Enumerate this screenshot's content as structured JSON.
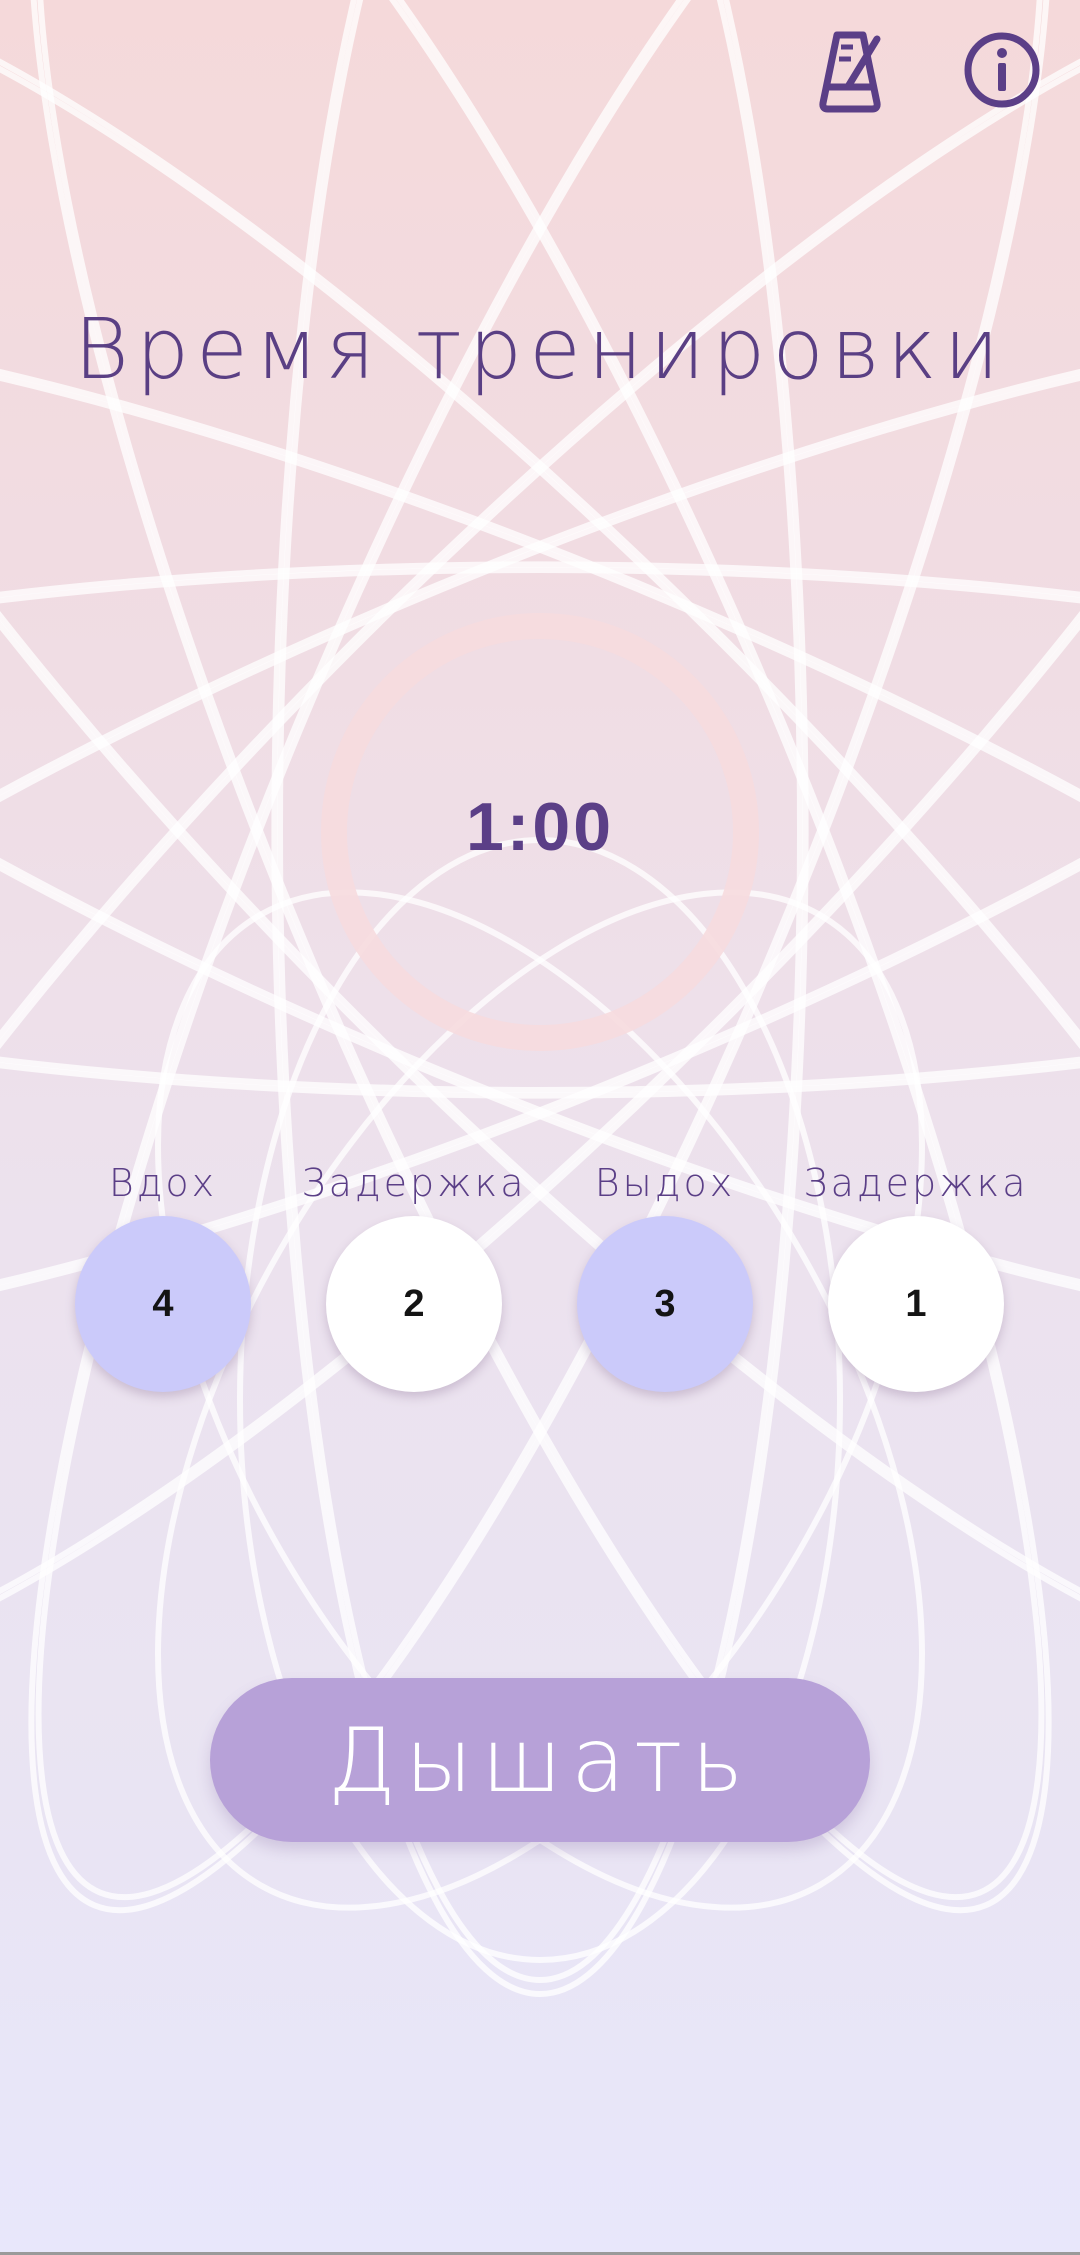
{
  "header": {
    "metronome_icon": "metronome-icon",
    "info_icon": "info-icon"
  },
  "title": "Время тренировки",
  "timer": {
    "value": "1:00"
  },
  "phases": [
    {
      "label": "Вдох",
      "value": "4",
      "color": "#cbcafa"
    },
    {
      "label": "Задержка",
      "value": "2",
      "color": "#ffffff"
    },
    {
      "label": "Выдох",
      "value": "3",
      "color": "#cbcafa"
    },
    {
      "label": "Задержка",
      "value": "1",
      "color": "#ffffff"
    }
  ],
  "action": {
    "label": "Дышать",
    "color": "#b7a1d8"
  },
  "colors": {
    "accent": "#5b3f87",
    "background_top": "#f5d9da",
    "background_bottom": "#e8e7fb"
  }
}
